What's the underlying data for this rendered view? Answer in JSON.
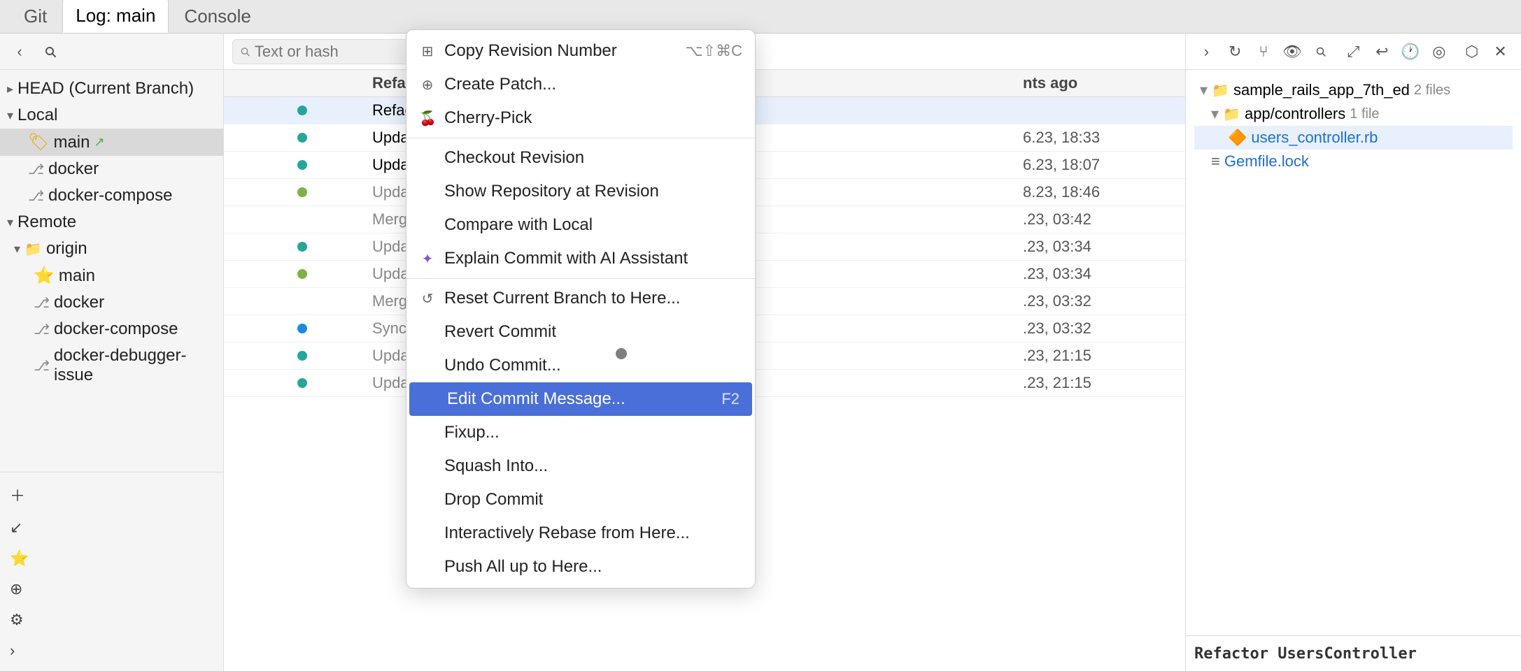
{
  "tabs": {
    "git_label": "Git",
    "log_label": "Log: main",
    "console_label": "Console"
  },
  "sidebar": {
    "search_placeholder": "Search",
    "head_label": "HEAD (Current Branch)",
    "local_label": "Local",
    "main_branch": "main",
    "docker_branch": "docker",
    "docker_compose_branch": "docker-compose",
    "remote_label": "Remote",
    "origin_label": "origin",
    "origin_main": "main",
    "origin_docker": "docker",
    "origin_docker_compose": "docker-compose",
    "origin_debugger": "docker-debugger-issue"
  },
  "log": {
    "search_placeholder": "Text or hash",
    "columns": {
      "graph": "",
      "message": "Refac",
      "author": "",
      "time": "nts ago"
    },
    "rows": [
      {
        "msg": "Refac",
        "bold": true,
        "time": "",
        "dot": "teal",
        "merge": false
      },
      {
        "msg": "Updat",
        "bold": true,
        "time": "6.23, 18:33",
        "dot": "teal",
        "merge": false
      },
      {
        "msg": "Updat",
        "bold": true,
        "time": "6.23, 18:07",
        "dot": "teal",
        "merge": false
      },
      {
        "msg": "Updat",
        "bold": false,
        "time": "8.23, 18:46",
        "dot": "olive",
        "merge": false
      },
      {
        "msg": "Merge",
        "bold": false,
        "time": ".23, 03:42",
        "dot": "",
        "merge": true
      },
      {
        "msg": "Updat",
        "bold": false,
        "time": ".23, 03:34",
        "dot": "teal",
        "merge": false
      },
      {
        "msg": "Updat",
        "bold": false,
        "time": ".23, 03:34",
        "dot": "olive",
        "merge": false
      },
      {
        "msg": "Merge",
        "bold": false,
        "time": ".23, 03:32",
        "dot": "",
        "merge": true
      },
      {
        "msg": "Sync u",
        "bold": false,
        "time": ".23, 03:32",
        "dot": "blue",
        "merge": false
      },
      {
        "msg": "Updat",
        "bold": false,
        "time": ".23, 21:15",
        "dot": "teal",
        "merge": false
      },
      {
        "msg": "Updat",
        "bold": false,
        "time": ".23, 21:15",
        "dot": "teal",
        "merge": false
      }
    ]
  },
  "right_panel": {
    "root_label": "sample_rails_app_7th_ed",
    "root_count": "2 files",
    "controllers_label": "app/controllers",
    "controllers_count": "1 file",
    "users_controller": "users_controller.rb",
    "gemfile_lock": "Gemfile.lock",
    "footer_text": "Refactor UsersController"
  },
  "context_menu": {
    "copy_revision": "Copy Revision Number",
    "copy_shortcut": "⌥⇧⌘C",
    "create_patch": "Create Patch...",
    "cherry_pick": "Cherry-Pick",
    "checkout_revision": "Checkout Revision",
    "show_repository": "Show Repository at Revision",
    "compare_with_local": "Compare with Local",
    "explain_commit": "Explain Commit with AI Assistant",
    "reset_branch": "Reset Current Branch to Here...",
    "revert_commit": "Revert Commit",
    "undo_commit": "Undo Commit...",
    "edit_commit_msg": "Edit Commit Message...",
    "edit_shortcut": "F2",
    "fixup": "Fixup...",
    "squash_into": "Squash Into...",
    "drop_commit": "Drop Commit",
    "interactively_rebase": "Interactively Rebase from Here...",
    "push_all_up": "Push All up to Here..."
  }
}
